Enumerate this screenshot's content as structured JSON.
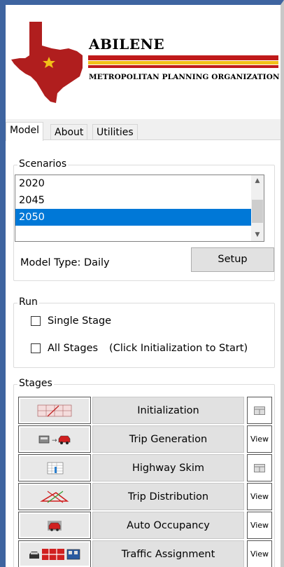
{
  "logo": {
    "name": "Abilene",
    "subtitle": "Metropolitan Planning Organization",
    "colors": {
      "texas": "#b01e1e",
      "star": "#f2c018",
      "stripe_red": "#c01a1a",
      "stripe_yellow": "#f2c018"
    }
  },
  "tabs": [
    {
      "label": "Model",
      "active": true
    },
    {
      "label": "About",
      "active": false
    },
    {
      "label": "Utilities",
      "active": false
    }
  ],
  "scenarios": {
    "label": "Scenarios",
    "items": [
      "2020",
      "2045",
      "2050"
    ],
    "selected": "2050",
    "model_type": "Model Type: Daily",
    "setup_label": "Setup"
  },
  "run": {
    "label": "Run",
    "single_stage": "Single Stage",
    "all_stages": "All Stages",
    "hint": "(Click Initialization to Start)"
  },
  "stages": {
    "label": "Stages",
    "items": [
      {
        "name": "Initialization",
        "icon": "grid-map-icon",
        "action": ""
      },
      {
        "name": "Trip Generation",
        "icon": "car-to-car-icon",
        "action": "View"
      },
      {
        "name": "Highway Skim",
        "icon": "skim-table-icon",
        "action": ""
      },
      {
        "name": "Trip Distribution",
        "icon": "distribution-triangle-icon",
        "action": "View"
      },
      {
        "name": "Auto Occupancy",
        "icon": "red-car-icon",
        "action": "View"
      },
      {
        "name": "Traffic Assignment",
        "icon": "vehicles-assignment-icon",
        "action": "View"
      }
    ]
  }
}
